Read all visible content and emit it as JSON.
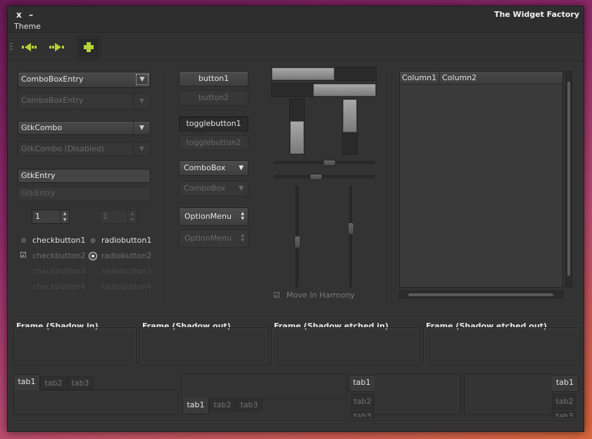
{
  "window": {
    "title": "The Widget Factory",
    "close_label": "x",
    "minimize_label": "–",
    "menu_theme": "Theme"
  },
  "toolbar": {
    "back_icon": "back-arrow-icon",
    "forward_icon": "forward-arrow-icon",
    "add_icon": "plus-icon",
    "accent_color": "#b6d334"
  },
  "combos": {
    "comboboxentry": "ComboBoxEntry",
    "comboboxentry_disabled": "ComboBoxEntry",
    "gtkcombo": "GtkCombo",
    "gtkcombo_disabled": "GtkCombo (Disabled)"
  },
  "entries": {
    "entry": "GtkEntry",
    "entry_disabled": "GtkEntry"
  },
  "spins": {
    "spin1": "1",
    "spin2": "1"
  },
  "checks": [
    {
      "label": "checkbutton1",
      "checked": false,
      "disabled": false
    },
    {
      "label": "checkbutton2",
      "checked": true,
      "disabled": true
    },
    {
      "label": "checkbutton3",
      "checked": false,
      "disabled": true
    },
    {
      "label": "checkbutton4",
      "checked": false,
      "disabled": true
    }
  ],
  "radios": [
    {
      "label": "radiobutton1",
      "checked": false,
      "disabled": false
    },
    {
      "label": "radiobutton2",
      "checked": true,
      "disabled": true
    },
    {
      "label": "radiobutton3",
      "checked": false,
      "disabled": true
    },
    {
      "label": "radiobutton4",
      "checked": false,
      "disabled": true
    }
  ],
  "buttons": {
    "button1": "button1",
    "button2": "button2",
    "toggle1": "togglebutton1",
    "toggle2": "togglebutton2",
    "combobox": "ComboBox",
    "combobox_disabled": "ComboBox",
    "optionmenu": "OptionMenu",
    "optionmenu_disabled": "OptionMenu"
  },
  "progress": {
    "h1": 0.6,
    "h2": 0.6,
    "v1": 0.6,
    "v2": 0.6
  },
  "scales": {
    "h1": 0.55,
    "h2": 0.4,
    "v1": 0.55,
    "v2": 0.4
  },
  "harmony": {
    "label": "Move In Harmony",
    "checked": true
  },
  "tree": {
    "columns": [
      "Column1",
      "Column2"
    ]
  },
  "frames": [
    "Frame (Shadow in)",
    "Frame (Shadow out)",
    "Frame (Shadow etched in)",
    "Frame (Shadow etched out)"
  ],
  "notebooks": {
    "tabs": [
      "tab1",
      "tab2",
      "tab3"
    ]
  }
}
